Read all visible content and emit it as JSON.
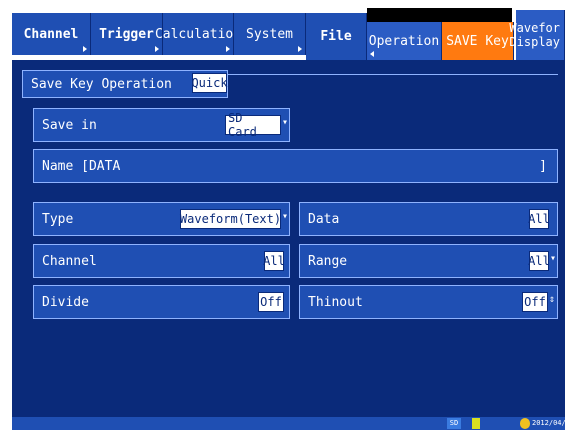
{
  "tabs": {
    "channel": "Channel",
    "trigger": "Trigger",
    "calculation": "Calculation",
    "system": "System",
    "file": "File",
    "operation": "Operation",
    "save_key": "SAVE Key",
    "waveform_line1": "Wavefor",
    "waveform_line2": "Display"
  },
  "section": {
    "title": "Save Key Operation",
    "mode": "Quick"
  },
  "settings": {
    "save_in_label": "Save in",
    "save_in_value": "SD Card",
    "name_label": "Name [DATA",
    "name_end": "]",
    "type_label": "Type",
    "type_value": "Waveform(Text)",
    "data_label": "Data",
    "data_value": "All",
    "channel_label": "Channel",
    "channel_value": "All",
    "range_label": "Range",
    "range_value": "All",
    "divide_label": "Divide",
    "divide_value": "Off",
    "thinout_label": "Thinout",
    "thinout_value": "Off"
  },
  "status": {
    "sd_label": "SD",
    "date": "2012/04/"
  },
  "colors": {
    "background": "#0a2a7a",
    "panel": "#1f4fb3",
    "accent": "#ff7a10"
  }
}
